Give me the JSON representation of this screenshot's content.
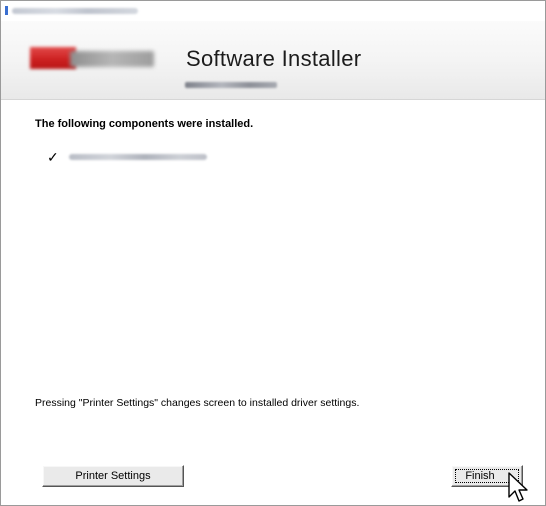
{
  "window": {
    "title_icon": "installer-app-icon"
  },
  "banner": {
    "title": "Software Installer",
    "logo": "brand-logo"
  },
  "content": {
    "heading": "The following components were installed.",
    "components": [
      {
        "check": "✓",
        "icon": "checkmark-icon"
      }
    ],
    "info": "Pressing \"Printer Settings\" changes screen to installed driver settings."
  },
  "buttons": {
    "printer_settings": "Printer Settings",
    "finish": "Finish"
  },
  "colors": {
    "logo_red": "#cc1f1f",
    "title_icon": "#3a6fd0"
  }
}
